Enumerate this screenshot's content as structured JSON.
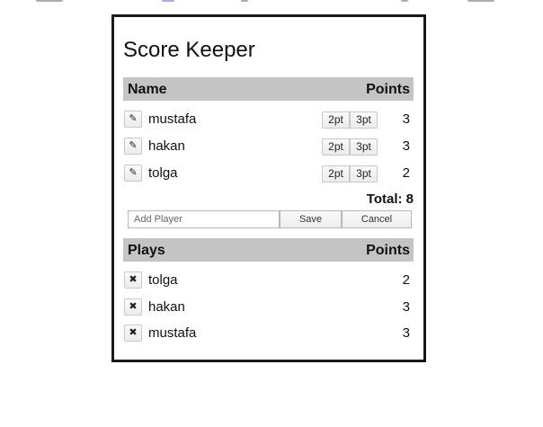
{
  "app": {
    "title": "Score Keeper"
  },
  "players_header": {
    "name_label": "Name",
    "points_label": "Points"
  },
  "players": [
    {
      "name": "mustafa",
      "points": "3",
      "edit_icon": "pencil-icon",
      "two_label": "2pt",
      "three_label": "3pt"
    },
    {
      "name": "hakan",
      "points": "3",
      "edit_icon": "pencil-icon",
      "two_label": "2pt",
      "three_label": "3pt"
    },
    {
      "name": "tolga",
      "points": "2",
      "edit_icon": "pencil-icon",
      "two_label": "2pt",
      "three_label": "3pt"
    }
  ],
  "total": {
    "text": "Total: 8"
  },
  "add_form": {
    "placeholder": "Add Player",
    "value": "",
    "save_label": "Save",
    "cancel_label": "Cancel"
  },
  "plays_header": {
    "plays_label": "Plays",
    "points_label": "Points"
  },
  "plays": [
    {
      "name": "tolga",
      "points": "2",
      "delete_icon": "x-icon"
    },
    {
      "name": "hakan",
      "points": "3",
      "delete_icon": "x-icon"
    },
    {
      "name": "mustafa",
      "points": "3",
      "delete_icon": "x-icon"
    }
  ],
  "colors": {
    "header_bg": "#c4c4c4",
    "card_border": "#1a1a1a"
  }
}
